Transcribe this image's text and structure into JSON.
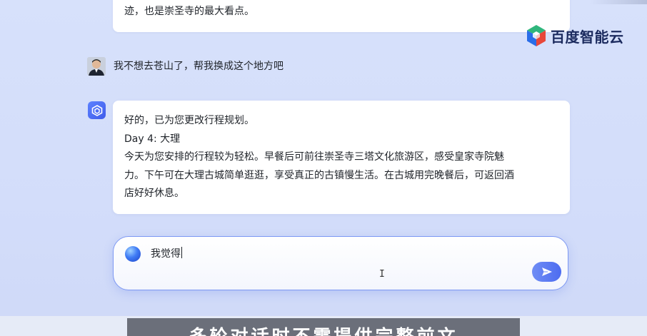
{
  "brand": {
    "name": "百度智能云",
    "logo_icon": "baidu-cloud-hexagon-icon"
  },
  "chat": {
    "previous_bot_tail": "迹，也是崇圣寺的最大看点。",
    "user_message": "我不想去苍山了，帮我换成这个地方吧",
    "bot_reply": {
      "lines": [
        "好的，已为您更改行程规划。",
        "Day 4: 大理",
        "今天为您安排的行程较为轻松。早餐后可前往崇圣寺三塔文化旅游区，感受皇家寺院魅",
        "力。下午可在大理古城简单逛逛，享受真正的古镇慢生活。在古城用完晚餐后，可返回酒",
        "店好好休息。"
      ]
    }
  },
  "input": {
    "value": "我觉得",
    "send_icon": "send-arrow-icon",
    "assistant_icon": "assistant-orb-icon"
  },
  "subtitle": "多轮对话时不需提供完整前文",
  "colors": {
    "accent": "#4d6cf0",
    "background": "#d7e1fb",
    "card": "#ffffff"
  }
}
